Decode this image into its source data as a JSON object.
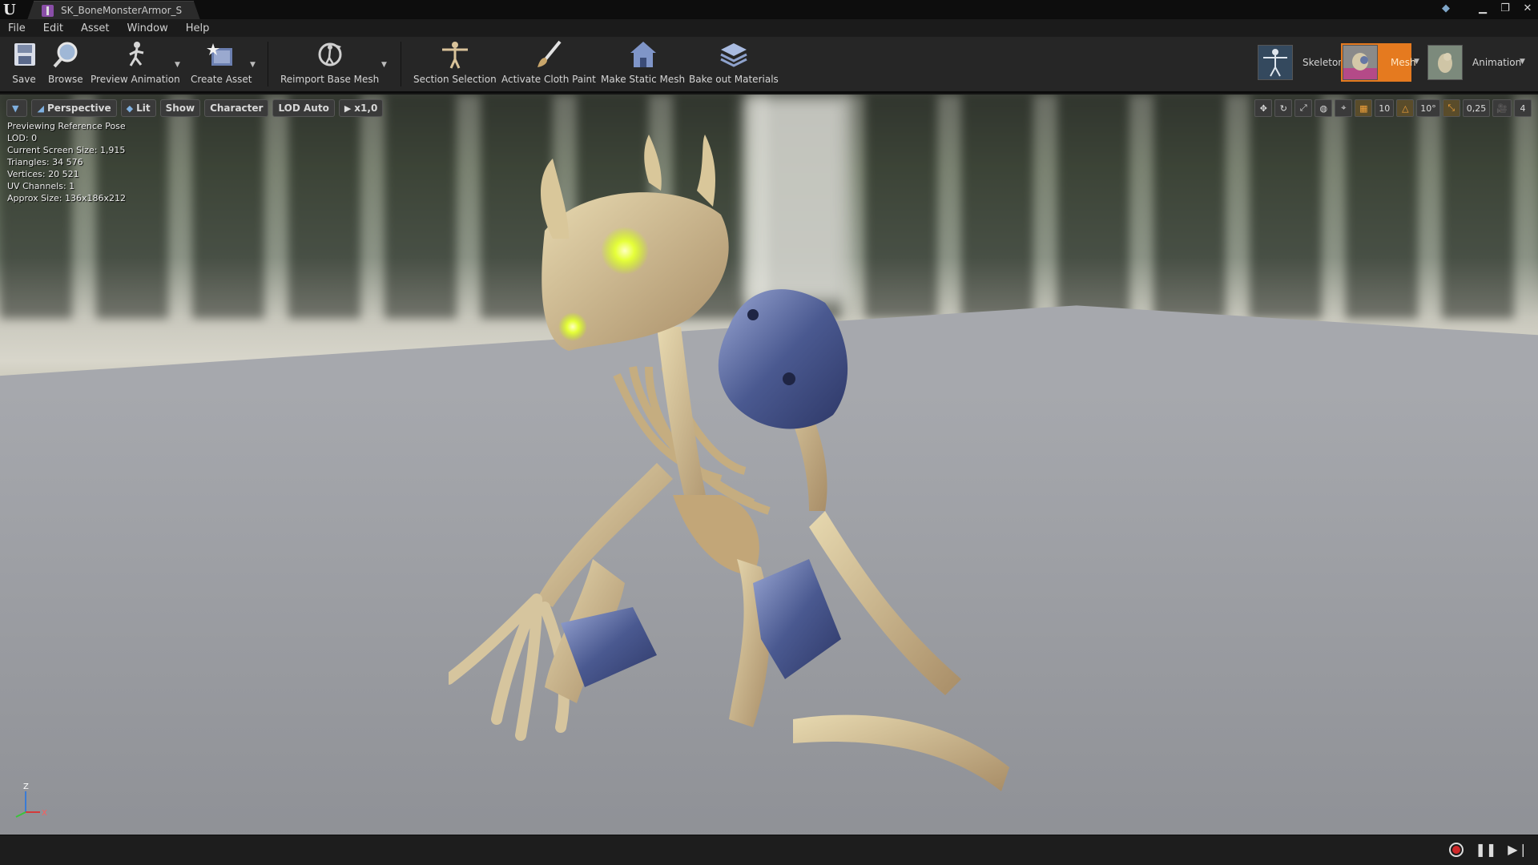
{
  "window": {
    "tab_title": "SK_BoneMonsterArmor_S",
    "controls": [
      "minimize-icon",
      "restore-icon",
      "close-icon"
    ]
  },
  "menu": [
    "File",
    "Edit",
    "Asset",
    "Window",
    "Help"
  ],
  "toolbar": {
    "save": "Save",
    "browse": "Browse",
    "preview_animation": "Preview Animation",
    "create_asset": "Create Asset",
    "reimport_base_mesh": "Reimport Base Mesh",
    "section_selection": "Section Selection",
    "activate_cloth_paint": "Activate Cloth Paint",
    "make_static_mesh": "Make Static Mesh",
    "bake_out_materials": "Bake out Materials"
  },
  "modes": {
    "skeleton": "Skeleton",
    "mesh": "Mesh",
    "animation": "Animation",
    "active": "Mesh",
    "active_color": "#e57a1f"
  },
  "viewport": {
    "view_mode": "Perspective",
    "lighting": "Lit",
    "show": "Show",
    "character": "Character",
    "lod": "LOD Auto",
    "play_rate": "x1,0",
    "grid_snap": "10",
    "rotation_snap": "10°",
    "scale_snap": "0,25",
    "camera_speed": "4"
  },
  "stats": {
    "line1": "Previewing Reference Pose",
    "line2": "LOD: 0",
    "line3": "Current Screen Size: 1,915",
    "line4": "Triangles: 34 576",
    "line5": "Vertices: 20 521",
    "line6": "UV Channels: 1",
    "line7": "Approx Size: 136x186x212"
  },
  "axis": {
    "z": "Z",
    "x": "X"
  }
}
